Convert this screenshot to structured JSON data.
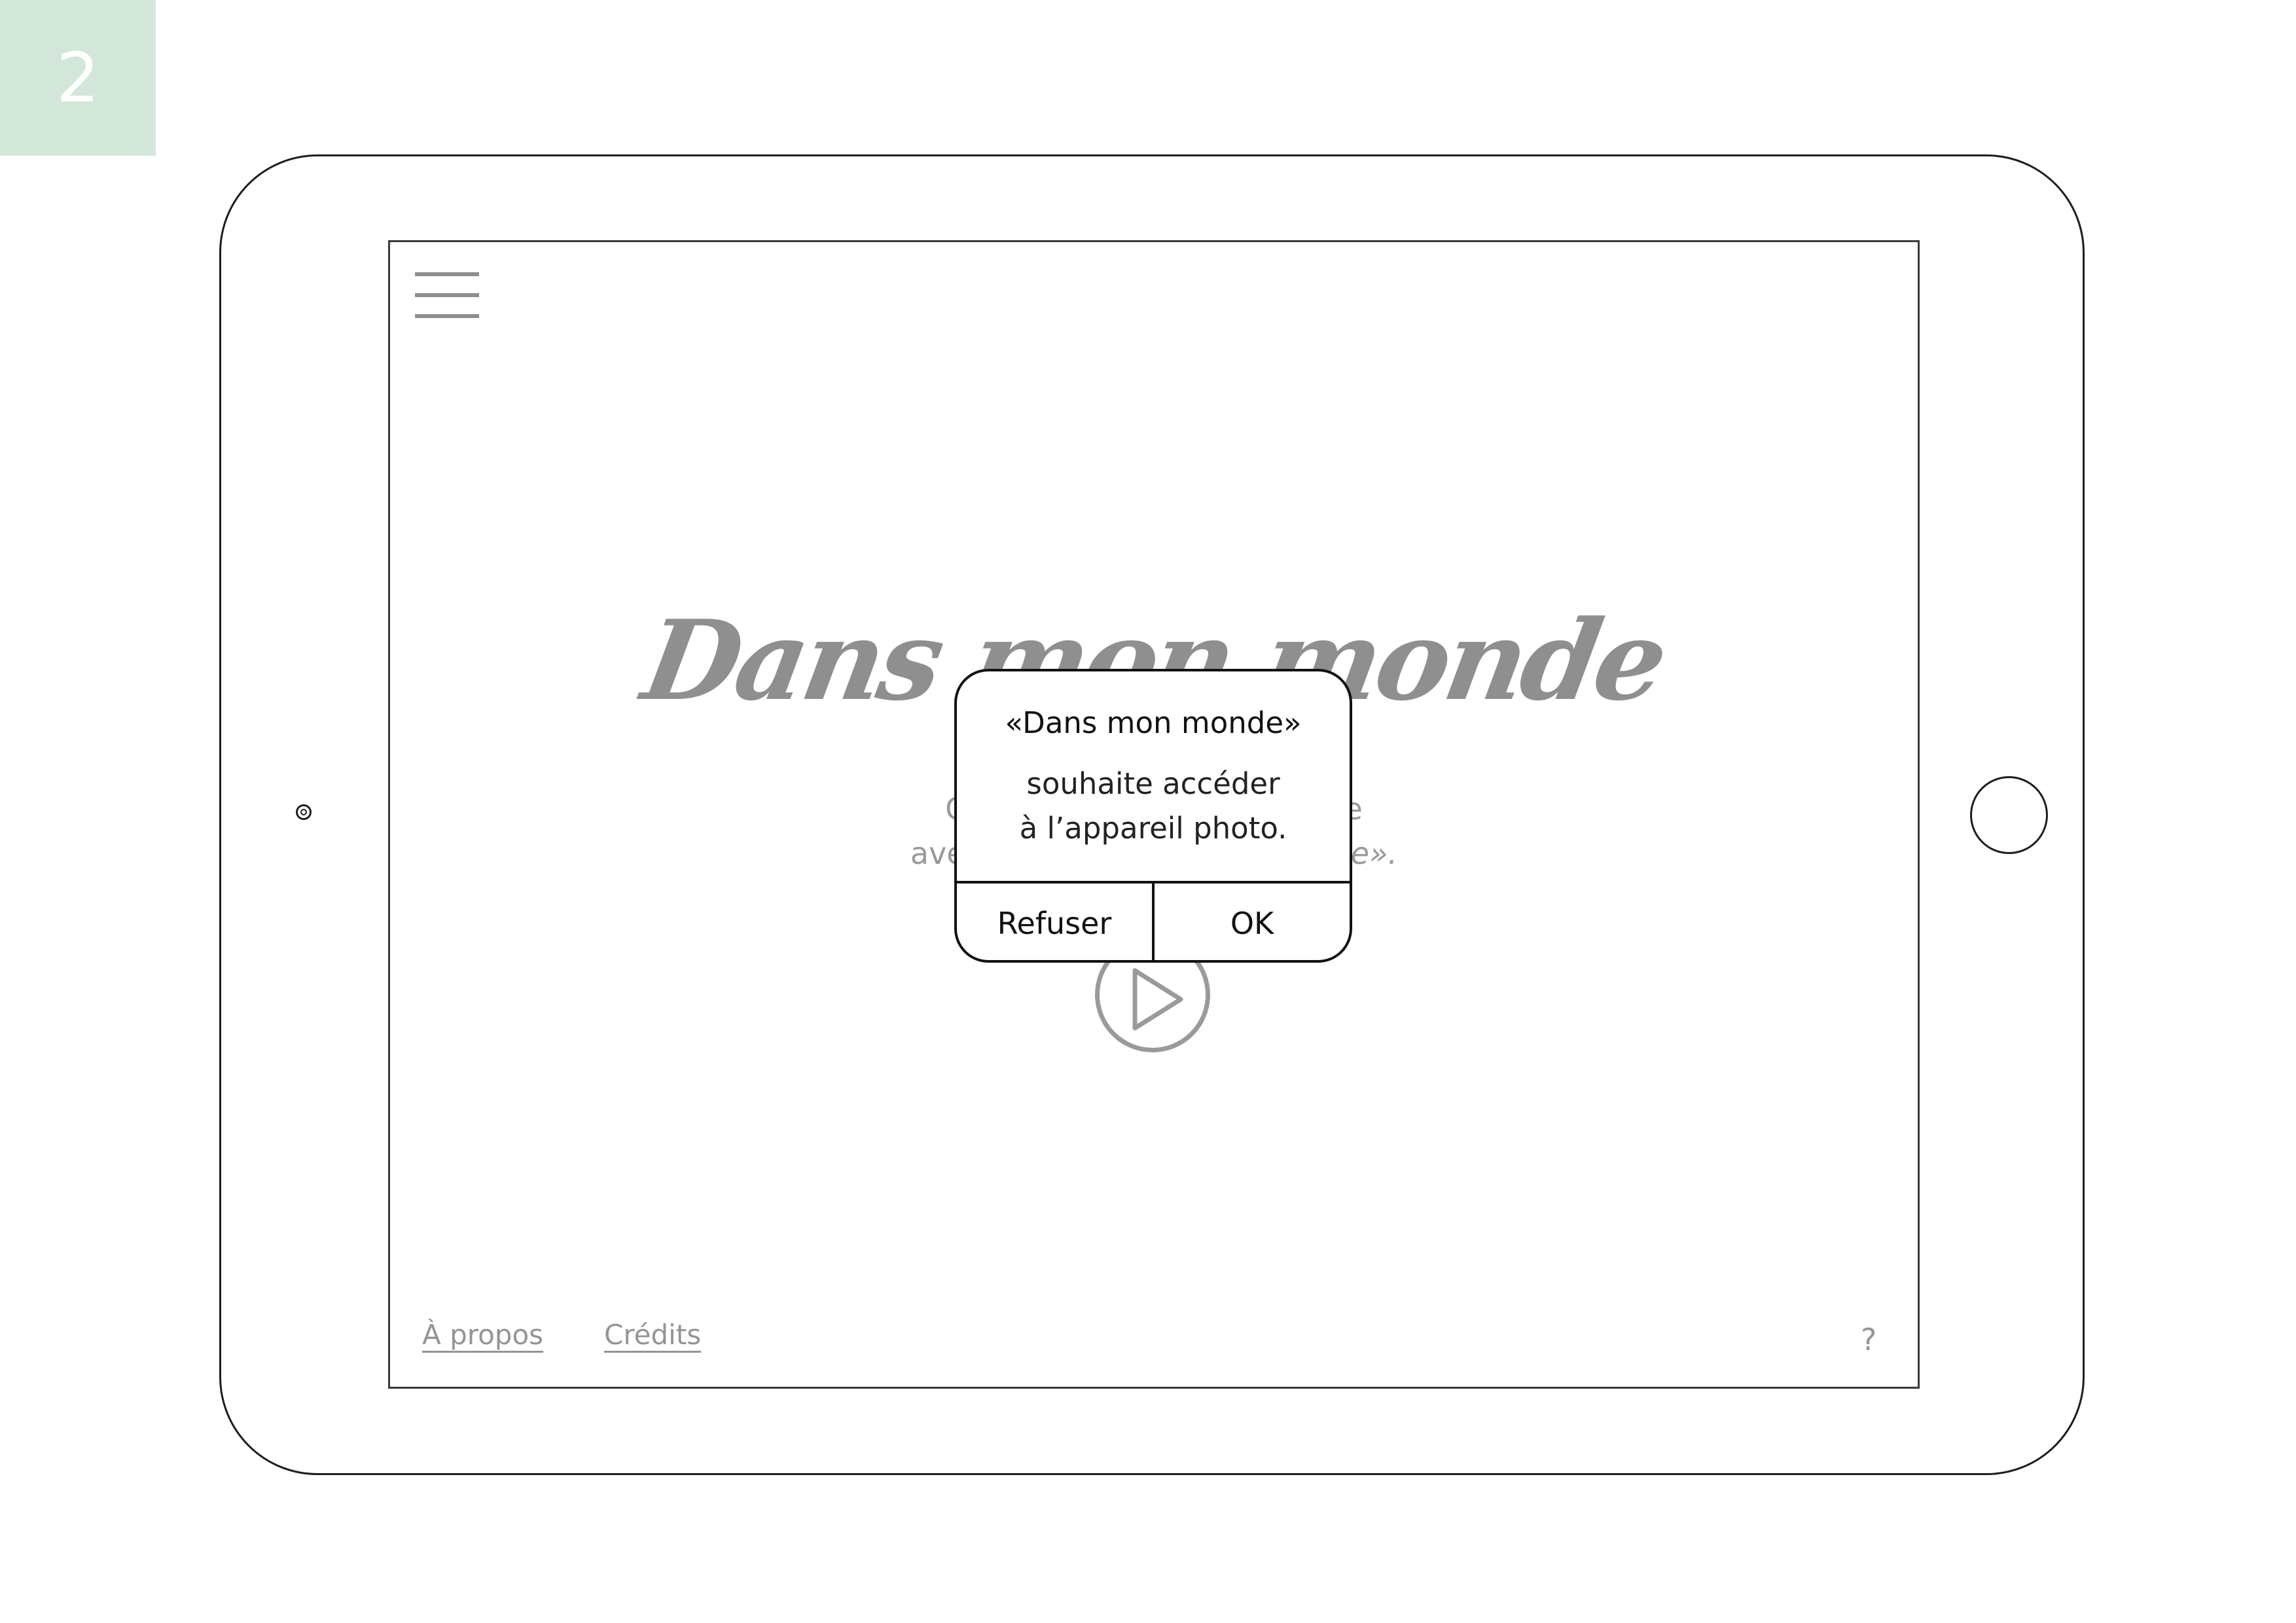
{
  "step_badge": "2",
  "colors": {
    "badge": "#d3e6da",
    "muted_text": "#959595",
    "outline": "#1e1e1e",
    "dialog_border": "#111111"
  },
  "icons": {
    "menu": "hamburger-icon",
    "play": "play-icon",
    "camera": "front-camera-icon",
    "home": "home-button"
  },
  "screen": {
    "title": "Dans mon monde",
    "intro_line1": "Co",
    "intro_line1_end": "ne",
    "intro_line2": "ave",
    "intro_line2_end": "de».",
    "footer": {
      "about": "À propos",
      "credits": "Crédits",
      "help": "?"
    }
  },
  "dialog": {
    "title": "«Dans mon monde»",
    "message_line1": "souhaite accéder",
    "message_line2": "à l’appareil photo.",
    "deny_label": "Refuser",
    "ok_label": "OK"
  }
}
